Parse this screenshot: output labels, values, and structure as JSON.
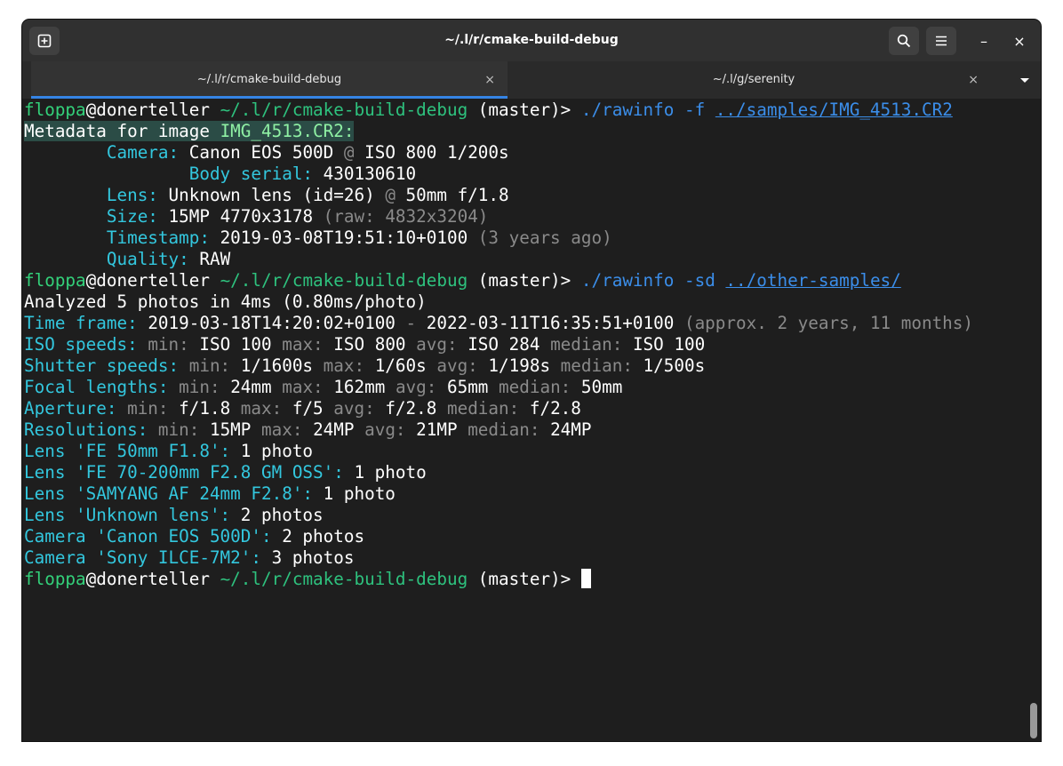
{
  "window": {
    "title": "~/.l/r/cmake-build-debug"
  },
  "tabs": [
    {
      "label": "~/.l/r/cmake-build-debug",
      "close": "×"
    },
    {
      "label": "~/.l/g/serenity",
      "close": "×"
    }
  ],
  "titlebar": {
    "minimize": "–",
    "close": "×"
  },
  "prompt": {
    "user": "floppa",
    "at": "@",
    "host": "donerteller",
    "path": "~/.l/r/cmake-build-debug",
    "branch": "(master)>"
  },
  "cmd1": {
    "exe": "./rawinfo",
    "flag": "-f",
    "arg": "../samples/IMG_4513.CR2"
  },
  "meta": {
    "header_prefix": "Metadata for image ",
    "header_file": "IMG_4513.CR2",
    "header_colon": ":",
    "camera_label": "Camera:",
    "camera_value": "Canon EOS 500D",
    "at": "@",
    "camera_rest": "ISO 800 1/200s",
    "serial_label": "Body serial:",
    "serial_value": "430130610",
    "lens_label": "Lens:",
    "lens_value": "Unknown lens (id=26)",
    "lens_rest": "50mm f/1.8",
    "size_label": "Size:",
    "size_value": "15MP 4770x3178",
    "size_raw": "(raw: 4832x3204)",
    "ts_label": "Timestamp:",
    "ts_value": "2019-03-08T19:51:10+0100",
    "ts_ago": "(3 years ago)",
    "quality_label": "Quality:",
    "quality_value": "RAW"
  },
  "cmd2": {
    "exe": "./rawinfo",
    "flag": "-sd",
    "arg": "../other-samples/"
  },
  "summary": {
    "analyzed": "Analyzed 5 photos in 4ms (0.80ms/photo)",
    "tf_label": "Time frame:",
    "tf_start": "2019-03-18T14:20:02+0100",
    "tf_dash": "-",
    "tf_end": "2022-03-11T16:35:51+0100",
    "tf_approx": "(approx. 2 years, 11 months)",
    "stats": [
      {
        "label": "ISO speeds:",
        "min_k": "min:",
        "min": "ISO 100",
        "max_k": "max:",
        "max": "ISO 800",
        "avg_k": "avg:",
        "avg": "ISO 284",
        "med_k": "median:",
        "med": "ISO 100"
      },
      {
        "label": "Shutter speeds:",
        "min_k": "min:",
        "min": "1/1600s",
        "max_k": "max:",
        "max": "1/60s",
        "avg_k": "avg:",
        "avg": "1/198s",
        "med_k": "median:",
        "med": "1/500s"
      },
      {
        "label": "Focal lengths:",
        "min_k": "min:",
        "min": "24mm",
        "max_k": "max:",
        "max": "162mm",
        "avg_k": "avg:",
        "avg": "65mm",
        "med_k": "median:",
        "med": "50mm"
      },
      {
        "label": "Aperture:",
        "min_k": "min:",
        "min": "f/1.8",
        "max_k": "max:",
        "max": "f/5",
        "avg_k": "avg:",
        "avg": "f/2.8",
        "med_k": "median:",
        "med": "f/2.8"
      },
      {
        "label": "Resolutions:",
        "min_k": "min:",
        "min": "15MP",
        "max_k": "max:",
        "max": "24MP",
        "avg_k": "avg:",
        "avg": "21MP",
        "med_k": "median:",
        "med": "24MP"
      }
    ],
    "counts": [
      {
        "label": "Lens 'FE 50mm F1.8':",
        "value": "1 photo"
      },
      {
        "label": "Lens 'FE 70-200mm F2.8 GM OSS':",
        "value": "1 photo"
      },
      {
        "label": "Lens 'SAMYANG AF 24mm F2.8':",
        "value": "1 photo"
      },
      {
        "label": "Lens 'Unknown lens':",
        "value": "2 photos"
      },
      {
        "label": "Camera 'Canon EOS 500D':",
        "value": "2 photos"
      },
      {
        "label": "Camera 'Sony ILCE-7M2':",
        "value": "3 photos"
      }
    ]
  },
  "colors": {
    "prompt_user": "#33d17a",
    "cyan": "#33c7de",
    "blue": "#3b8eea",
    "accent": "#3584e4",
    "background": "#1e1e1e"
  }
}
